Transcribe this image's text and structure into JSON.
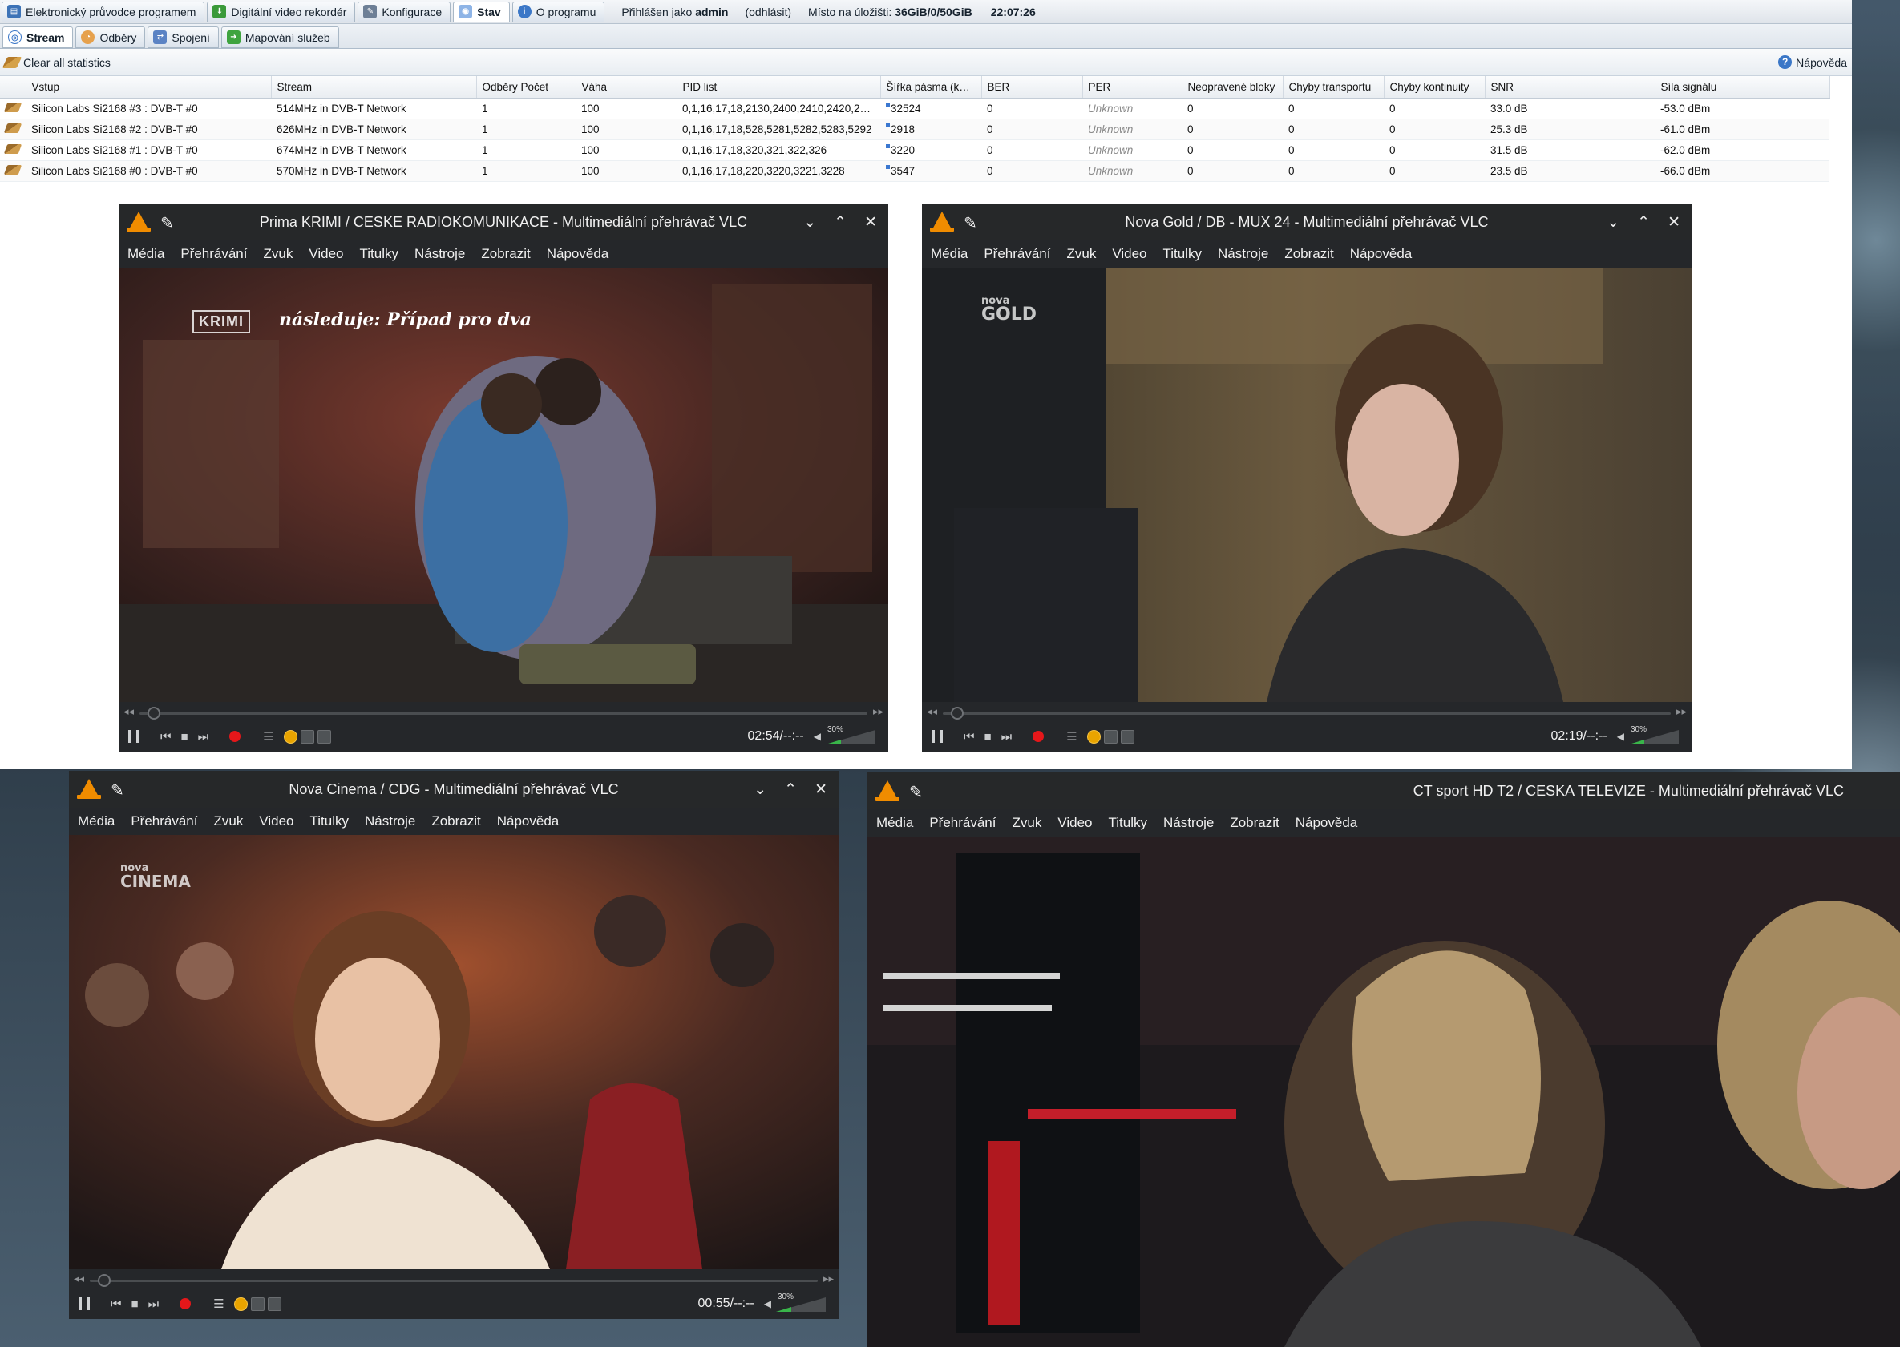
{
  "tvh": {
    "top_tabs": [
      {
        "label": "Elektronický průvodce programem",
        "icon": "epg-icon"
      },
      {
        "label": "Digitální video rekordér",
        "icon": "download-icon"
      },
      {
        "label": "Konfigurace",
        "icon": "wrench-icon"
      },
      {
        "label": "Stav",
        "icon": "eye-icon",
        "active": true
      },
      {
        "label": "O programu",
        "icon": "info-icon"
      }
    ],
    "login_prefix": "Přihlášen jako",
    "user": "admin",
    "logout": "(odhlásit)",
    "storage_label": "Místo na úložišti:",
    "storage_value": "36GiB/0/50GiB",
    "clock": "22:07:26",
    "sub_tabs": [
      {
        "label": "Stream",
        "icon": "stream-icon",
        "active": true
      },
      {
        "label": "Odběry",
        "icon": "subscriptions-icon"
      },
      {
        "label": "Spojení",
        "icon": "connection-icon"
      },
      {
        "label": "Mapování služeb",
        "icon": "arrow-right-icon"
      }
    ],
    "clear_stats": "Clear all statistics",
    "help": "Nápověda",
    "columns": [
      "Vstup",
      "Stream",
      "Odběry Počet",
      "Váha",
      "PID list",
      "Šířka pásma (k…",
      "BER",
      "PER",
      "Neopravené bloky",
      "Chyby transportu",
      "Chyby kontinuity",
      "SNR",
      "Síla signálu"
    ],
    "rows": [
      [
        "Silicon Labs Si2168 #3 : DVB-T #0",
        "514MHz in DVB-T Network",
        "1",
        "100",
        "0,1,16,17,18,2130,2400,2410,2420,2…",
        "32524",
        "0",
        "Unknown",
        "0",
        "0",
        "0",
        "33.0 dB",
        "-53.0 dBm"
      ],
      [
        "Silicon Labs Si2168 #2 : DVB-T #0",
        "626MHz in DVB-T Network",
        "1",
        "100",
        "0,1,16,17,18,528,5281,5282,5283,5292",
        "2918",
        "0",
        "Unknown",
        "0",
        "0",
        "0",
        "25.3 dB",
        "-61.0 dBm"
      ],
      [
        "Silicon Labs Si2168 #1 : DVB-T #0",
        "674MHz in DVB-T Network",
        "1",
        "100",
        "0,1,16,17,18,320,321,322,326",
        "3220",
        "0",
        "Unknown",
        "0",
        "0",
        "0",
        "31.5 dB",
        "-62.0 dBm"
      ],
      [
        "Silicon Labs Si2168 #0 : DVB-T #0",
        "570MHz in DVB-T Network",
        "1",
        "100",
        "0,1,16,17,18,220,3220,3221,3228",
        "3547",
        "0",
        "Unknown",
        "0",
        "0",
        "0",
        "23.5 dB",
        "-66.0 dBm"
      ]
    ]
  },
  "vlc_menu": [
    "Média",
    "Přehrávání",
    "Zvuk",
    "Video",
    "Titulky",
    "Nástroje",
    "Zobrazit",
    "Nápověda"
  ],
  "vlc_windows": [
    {
      "title": "Prima KRIMI / CESKE RADIOKOMUNIKACE - Multimediální přehrávač VLC",
      "time": "02:54/--:--",
      "volume": "30%",
      "channel_logo": "KRIMI",
      "overlay_text": "následuje: Případ pro dva"
    },
    {
      "title": "Nova Gold / DB - MUX 24 - Multimediální přehrávač VLC",
      "time": "02:19/--:--",
      "volume": "30%",
      "channel_logo_top": "nova",
      "channel_logo": "GOLD"
    },
    {
      "title": "Nova Cinema / CDG - Multimediální přehrávač VLC",
      "time": "00:55/--:--",
      "volume": "30%",
      "channel_logo_top": "nova",
      "channel_logo": "CINEMA"
    },
    {
      "title": "CT sport HD T2 / CESKA TELEVIZE - Multimediální přehrávač VLC"
    }
  ],
  "colors": {
    "vlc_bg": "#25272a",
    "vlc_orange": "#f08c00",
    "record_red": "#e5171a",
    "volume_green": "#39b54a",
    "tvh_header": "#dfe4ea"
  }
}
